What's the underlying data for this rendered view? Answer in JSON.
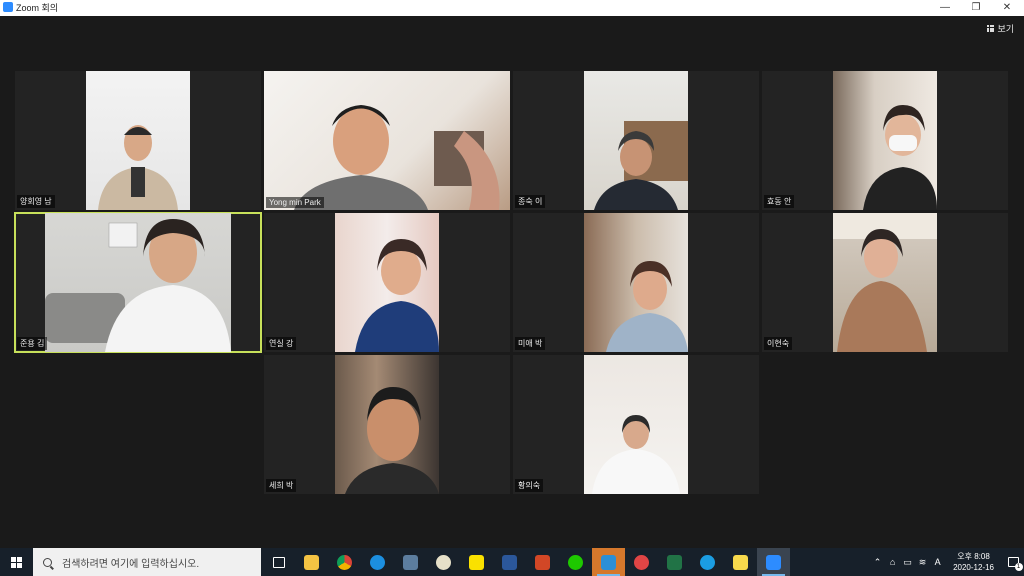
{
  "window": {
    "title": "Zoom 회의",
    "minimize": "—",
    "restore": "❐",
    "close": "✕"
  },
  "toolbar": {
    "view_label": "보기"
  },
  "participants": [
    {
      "name": "양회영 남"
    },
    {
      "name": "Yong min Park"
    },
    {
      "name": "종숙 이"
    },
    {
      "name": "효동 안"
    },
    {
      "name": "준용 김",
      "active_speaker": true
    },
    {
      "name": "연실 강"
    },
    {
      "name": "미애 박"
    },
    {
      "name": "이현숙"
    },
    {
      "name": "세희 박"
    },
    {
      "name": "황의숙"
    }
  ],
  "taskbar": {
    "search_placeholder": "검색하려면 여기에 입력하십시오.",
    "apps": [
      "task-view",
      "file-explorer",
      "chrome",
      "internet-explorer",
      "calculator",
      "paint",
      "kakaotalk",
      "word",
      "powerpoint",
      "naver-whale",
      "capture",
      "app-refresh",
      "excel",
      "edge",
      "sticky-notes",
      "zoom"
    ],
    "tray": {
      "ime": "A",
      "time": "오후 8:08",
      "date": "2020-12-16",
      "notifications": "1"
    }
  },
  "colors": {
    "active_border": "#c7e05a",
    "background": "#1a1a1a",
    "taskbar": "#17202a"
  }
}
